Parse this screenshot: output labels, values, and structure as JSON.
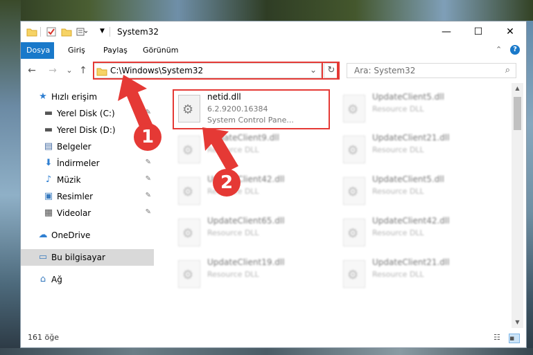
{
  "window": {
    "title": "System32",
    "minimize": "—",
    "maximize": "☐",
    "close": "✕"
  },
  "ribbon": {
    "tabs": [
      "Dosya",
      "Giriş",
      "Paylaş",
      "Görünüm"
    ],
    "help": "?",
    "collapse": "⌃"
  },
  "address": {
    "path": "C:\\Windows\\System32",
    "back": "←",
    "forward": "→",
    "recent": "⌄",
    "up": "↑",
    "dropdown": "⌄",
    "refresh": "↻"
  },
  "search": {
    "placeholder": "Ara: System32",
    "icon": "search-icon"
  },
  "sidebar": {
    "items": [
      {
        "label": "Hızlı erişim",
        "icon": "star-icon",
        "glyph": "★"
      },
      {
        "label": "Yerel Disk (C:)",
        "icon": "drive-icon",
        "glyph": "▬"
      },
      {
        "label": "Yerel Disk (D:)",
        "icon": "drive-icon",
        "glyph": "▬"
      },
      {
        "label": "Belgeler",
        "icon": "documents-icon",
        "glyph": "▤"
      },
      {
        "label": "İndirmeler",
        "icon": "download-icon",
        "glyph": "⬇"
      },
      {
        "label": "Müzik",
        "icon": "music-icon",
        "glyph": "♪"
      },
      {
        "label": "Resimler",
        "icon": "pictures-icon",
        "glyph": "▣"
      },
      {
        "label": "Videolar",
        "icon": "videos-icon",
        "glyph": "▦"
      },
      {
        "label": "OneDrive",
        "icon": "cloud-icon",
        "glyph": "☁"
      },
      {
        "label": "Bu bilgisayar",
        "icon": "computer-icon",
        "glyph": "▭"
      },
      {
        "label": "Ağ",
        "icon": "network-icon",
        "glyph": "⌂"
      }
    ],
    "pin": "📌"
  },
  "files": [
    {
      "name": "netid.dll",
      "line1": "6.2.9200.16384",
      "line2": "System Control Pane..."
    },
    {
      "name": "UpdateClient5.dll",
      "line1": "Resource DLL",
      "line2": ""
    },
    {
      "name": "UpdateClient9.dll",
      "line1": "Resource DLL",
      "line2": ""
    },
    {
      "name": "UpdateClient21.dll",
      "line1": "Resource DLL",
      "line2": ""
    },
    {
      "name": "UpdateClient42.dll",
      "line1": "Resource DLL",
      "line2": ""
    },
    {
      "name": "UpdateClient5.dll",
      "line1": "Resource DLL",
      "line2": ""
    },
    {
      "name": "UpdateClient65.dll",
      "line1": "Resource DLL",
      "line2": ""
    },
    {
      "name": "UpdateClient42.dll",
      "line1": "Resource DLL",
      "line2": ""
    },
    {
      "name": "UpdateClient19.dll",
      "line1": "Resource DLL",
      "line2": ""
    },
    {
      "name": "UpdateClient21.dll",
      "line1": "Resource DLL",
      "line2": ""
    }
  ],
  "status": {
    "count": "161 öğe"
  },
  "annotations": {
    "step1": "1",
    "step2": "2",
    "highlight_color": "#e53935",
    "accent": "#1979ca"
  }
}
